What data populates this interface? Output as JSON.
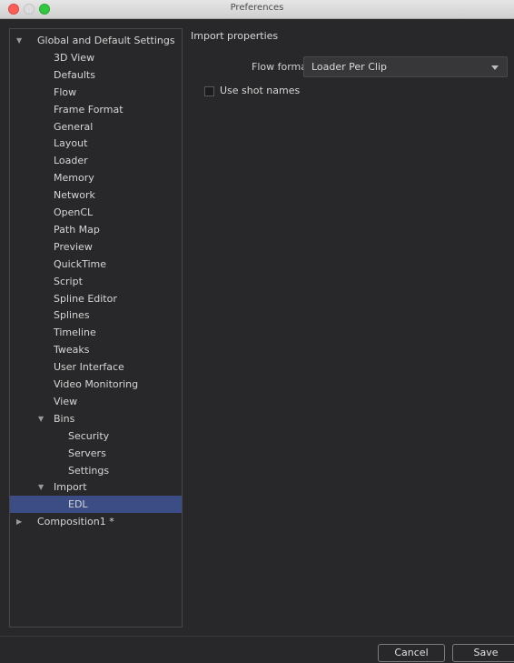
{
  "window": {
    "title": "Preferences"
  },
  "sidebar": {
    "items": [
      {
        "label": "Global and Default Settings",
        "indent": 0,
        "expander": "expanded"
      },
      {
        "label": "3D View",
        "indent": 1
      },
      {
        "label": "Defaults",
        "indent": 1
      },
      {
        "label": "Flow",
        "indent": 1
      },
      {
        "label": "Frame Format",
        "indent": 1
      },
      {
        "label": "General",
        "indent": 1
      },
      {
        "label": "Layout",
        "indent": 1
      },
      {
        "label": "Loader",
        "indent": 1
      },
      {
        "label": "Memory",
        "indent": 1
      },
      {
        "label": "Network",
        "indent": 1
      },
      {
        "label": "OpenCL",
        "indent": 1
      },
      {
        "label": "Path Map",
        "indent": 1
      },
      {
        "label": "Preview",
        "indent": 1
      },
      {
        "label": "QuickTime",
        "indent": 1
      },
      {
        "label": "Script",
        "indent": 1
      },
      {
        "label": "Spline Editor",
        "indent": 1
      },
      {
        "label": "Splines",
        "indent": 1
      },
      {
        "label": "Timeline",
        "indent": 1
      },
      {
        "label": "Tweaks",
        "indent": 1
      },
      {
        "label": "User Interface",
        "indent": 1
      },
      {
        "label": "Video Monitoring",
        "indent": 1
      },
      {
        "label": "View",
        "indent": 1
      },
      {
        "label": "Bins",
        "indent": 1,
        "expander": "expanded"
      },
      {
        "label": "Security",
        "indent": 2
      },
      {
        "label": "Servers",
        "indent": 2
      },
      {
        "label": "Settings",
        "indent": 2
      },
      {
        "label": "Import",
        "indent": 1,
        "expander": "expanded"
      },
      {
        "label": "EDL",
        "indent": 2,
        "selected": true
      },
      {
        "label": "Composition1 *",
        "indent": 0,
        "expander": "collapsed"
      }
    ]
  },
  "content": {
    "title": "Import properties",
    "flow_format": {
      "label": "Flow format:",
      "value": "Loader Per Clip"
    },
    "use_shot_names": {
      "label": "Use shot names",
      "checked": false
    }
  },
  "buttons": {
    "cancel": "Cancel",
    "save": "Save"
  },
  "colors": {
    "selection": "#3c4d85",
    "background": "#28282a",
    "close": "#fc5f57",
    "zoom": "#31c840"
  },
  "icons": {
    "expanded": "triangle-down",
    "collapsed": "triangle-right",
    "dropdown": "chevron-down"
  }
}
